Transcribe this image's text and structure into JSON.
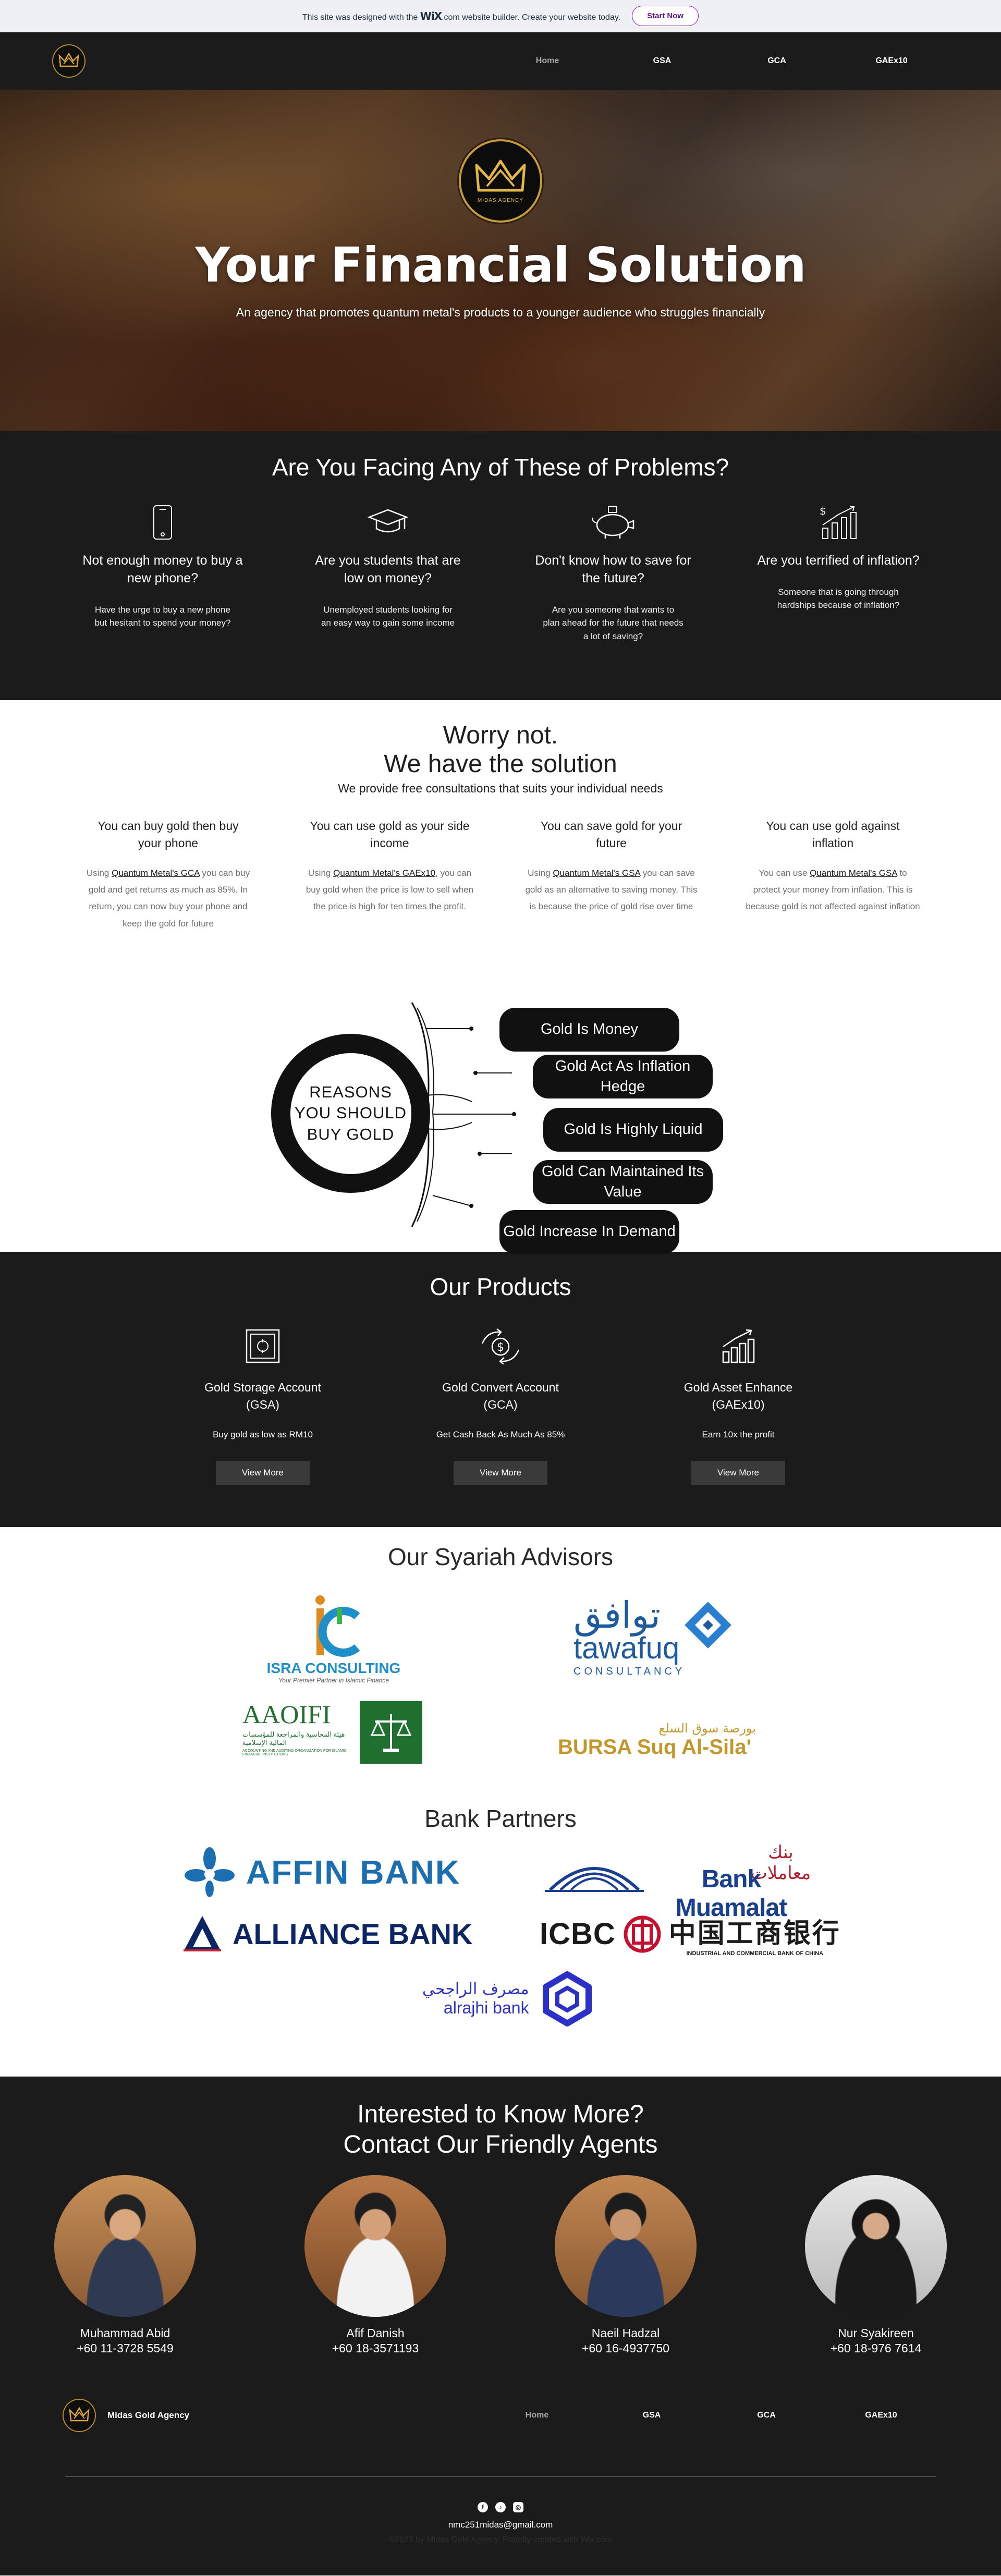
{
  "wix_banner": {
    "message_pre": "This site was designed with the ",
    "brand": "WiX",
    "message_post": ".com website builder. Create your website today.",
    "cta": "Start Now"
  },
  "nav": {
    "items": [
      "Home",
      "GSA",
      "GCA",
      "GAEx10"
    ],
    "active": "Home"
  },
  "hero": {
    "logo_text": "MIDAS AGENCY",
    "title": "Your Financial Solution",
    "subtitle": "An agency that promotes quantum metal's products to a younger audience who struggles financially"
  },
  "problems": {
    "heading": "Are You Facing Any of These of Problems?",
    "items": [
      {
        "icon": "phone-icon",
        "title": "Not enough money to buy a new phone?",
        "text": "Have the urge to buy a new phone but hesitant to spend your money?"
      },
      {
        "icon": "graduation-cap-icon",
        "title": "Are you students that are low on money?",
        "text": "Unemployed students looking for an easy way to gain some income"
      },
      {
        "icon": "piggy-bank-icon",
        "title": "Don't know how to save for the future?",
        "text": "Are you someone that wants to plan ahead for the future that needs a lot of saving?"
      },
      {
        "icon": "growth-chart-icon",
        "title": "Are you terrified of inflation?",
        "text": "Someone that is going through hardships because of inflation?"
      }
    ]
  },
  "solution": {
    "heading_line1": "Worry not.",
    "heading_line2": "We have the solution",
    "sub": "We provide free consultations that suits your individual needs",
    "items": [
      {
        "title": "You can buy gold then buy your phone",
        "pre": "Using ",
        "link": "Quantum Metal's GCA",
        "post": " you can buy gold and get returns as much as 85%. In return, you can now buy your phone and keep the gold for future"
      },
      {
        "title": "You can use gold as your side income",
        "pre": "Using ",
        "link": "Quantum Metal's GAEx10",
        "post": ", you can buy gold when the price is low to sell when the price is high for ten times the profit."
      },
      {
        "title": "You can save gold for your future",
        "pre": "Using ",
        "link": "Quantum Metal's GSA",
        "post": " you can save gold as an alternative to saving money. This is because the price of gold rise over time"
      },
      {
        "title": "You can use gold against inflation",
        "pre": "You can use ",
        "link": "Quantum Metal's GSA",
        "post": " to protect your money from inflation. This is because gold is not affected against inflation"
      }
    ]
  },
  "reasons": {
    "center_text": "REASONS YOU SHOULD BUY GOLD",
    "pills": [
      "Gold Is Money",
      "Gold Act As Inflation Hedge",
      "Gold Is Highly Liquid",
      "Gold Can Maintained Its Value",
      "Gold Increase In Demand"
    ]
  },
  "products": {
    "heading": "Our Products",
    "items": [
      {
        "icon": "vault-icon",
        "title_line1": "Gold Storage Account",
        "title_line2": "(GSA)",
        "text": "Buy gold as low as RM10",
        "button": "View More"
      },
      {
        "icon": "dollar-exchange-icon",
        "title_line1": "Gold Convert Account",
        "title_line2": "(GCA)",
        "text": "Get Cash Back As Much As 85%",
        "button": "View More"
      },
      {
        "icon": "rising-bars-icon",
        "title_line1": "Gold Asset Enhance",
        "title_line2": "(GAEx10)",
        "text": "Earn 10x the profit",
        "button": "View More"
      }
    ]
  },
  "syariah": {
    "heading": "Our Syariah Advisors",
    "logos": {
      "isra": {
        "name": "ISRA CONSULTING",
        "tagline": "Your Premier Partner in Islamic Finance"
      },
      "tawafuq": {
        "arabic": "توافق",
        "name": "tawafuq",
        "tagline": "CONSULTANCY"
      },
      "aaoifi": {
        "name": "AAOIFI",
        "arabic": "هيئة المحاسبة والمراجعة للمؤسسات المالية الإسلامية",
        "tagline": "ACCOUNTING AND AUDITING ORGANIZATION FOR ISLAMIC FINANCIAL INSTITUTIONS"
      },
      "bursa": {
        "arabic": "بورصة سوق السلع",
        "name": "BURSA Suq Al-Sila'"
      }
    }
  },
  "banks": {
    "heading": "Bank Partners",
    "logos": {
      "affin": "AFFIN BANK",
      "muamalat": "Bank Muamalat",
      "muamalat_arabic": "بنك معاملات",
      "alliance": "ALLIANCE BANK",
      "icbc": "ICBC",
      "icbc_chinese": "中国工商银行",
      "icbc_sub": "INDUSTRIAL AND COMMERCIAL BANK OF CHINA",
      "alrajhi": "alrajhi bank",
      "alrajhi_arabic": "مصرف الراجحي"
    }
  },
  "contact": {
    "heading_line1": "Interested to Know More?",
    "heading_line2": "Contact Our Friendly Agents",
    "agents": [
      {
        "name": "Muhammad Abid",
        "phone": "+60 11-3728 5549"
      },
      {
        "name": "Afif Danish",
        "phone": "+60 18-3571193"
      },
      {
        "name": "Naeil Hadzal",
        "phone": "+60 16-4937750"
      },
      {
        "name": "Nur Syakireen",
        "phone": "+60 18-976 7614"
      }
    ]
  },
  "footer": {
    "brand": "Midas Gold Agency",
    "nav": [
      "Home",
      "GSA",
      "GCA",
      "GAEx10"
    ],
    "social": [
      "facebook-icon",
      "tiktok-icon",
      "instagram-icon"
    ],
    "email": "nmc251midas@gmail.com",
    "copyright": "©2023 by Midas Gold Agency. Proudly created with Wix.com"
  },
  "colors": {
    "dark": "#1b1b1b",
    "gold": "#c49a3a",
    "wix_purple": "#7a1fa2"
  }
}
